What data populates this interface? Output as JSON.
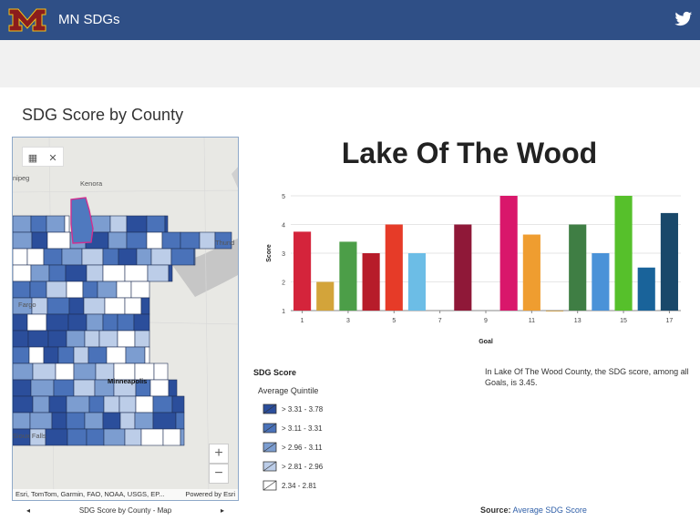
{
  "header": {
    "title": "MN SDGs",
    "logo_icon": "university-m-logo",
    "social_icon": "twitter-icon",
    "bar_color": "#2f4f86",
    "logo_color": "#8b1c1c"
  },
  "section": {
    "title": "SDG Score by County"
  },
  "map": {
    "labels": [
      "nipeg",
      "Kenora",
      "Thund",
      "Fargo",
      "Minneapolis",
      "Sioux Falls"
    ],
    "attribution_left": "Esri, TomTom, Garmin, FAO, NOAA, USGS, EP...",
    "attribution_right": "Powered by Esri",
    "zoom_in": "+",
    "zoom_out": "−",
    "footer_title": "SDG Score by County - Map",
    "prev": "◂",
    "next": "▸"
  },
  "county": {
    "name": "Lake Of The Wood"
  },
  "chart_data": {
    "type": "bar",
    "xlabel": "Goal",
    "ylabel": "Score",
    "ylim": [
      1,
      5
    ],
    "yticks": [
      1,
      2,
      3,
      4,
      5
    ],
    "xticks": [
      "1",
      "3",
      "5",
      "7",
      "9",
      "11",
      "13",
      "15",
      "17"
    ],
    "categories": [
      "1",
      "2",
      "3",
      "4",
      "5",
      "6",
      "7",
      "8",
      "9",
      "10",
      "11",
      "12",
      "13",
      "14",
      "15",
      "16",
      "17"
    ],
    "values": [
      3.75,
      2.0,
      3.4,
      3.0,
      4.0,
      3.0,
      null,
      4.0,
      null,
      5.0,
      3.65,
      1.0,
      4.0,
      3.0,
      5.0,
      2.5,
      4.4
    ],
    "colors": [
      "#d4243b",
      "#d3a43a",
      "#4c9e48",
      "#b71c2a",
      "#e63b28",
      "#6cbde6",
      "#f4c30f",
      "#8f1838",
      "#f36b24",
      "#d9176b",
      "#ef9d30",
      "#bf8b2e",
      "#3f7e44",
      "#4a92d8",
      "#56c02b",
      "#19639a",
      "#19486a"
    ]
  },
  "legend": {
    "title": "SDG Score",
    "subtitle": "Average Quintile",
    "items": [
      {
        "label": "> 3.31 - 3.78",
        "color": "#2b4e9b"
      },
      {
        "label": "> 3.11 - 3.31",
        "color": "#4a72b9"
      },
      {
        "label": "> 2.96 - 3.11",
        "color": "#7c9dd0"
      },
      {
        "label": "> 2.81 - 2.96",
        "color": "#bccde8"
      },
      {
        "label": "2.34 - 2.81",
        "color": "#ffffff"
      }
    ]
  },
  "summary": {
    "text": "In Lake Of The Wood County, the SDG score, among all Goals, is 3.45."
  },
  "source": {
    "label": "Source:",
    "link": "Average SDG Score"
  }
}
